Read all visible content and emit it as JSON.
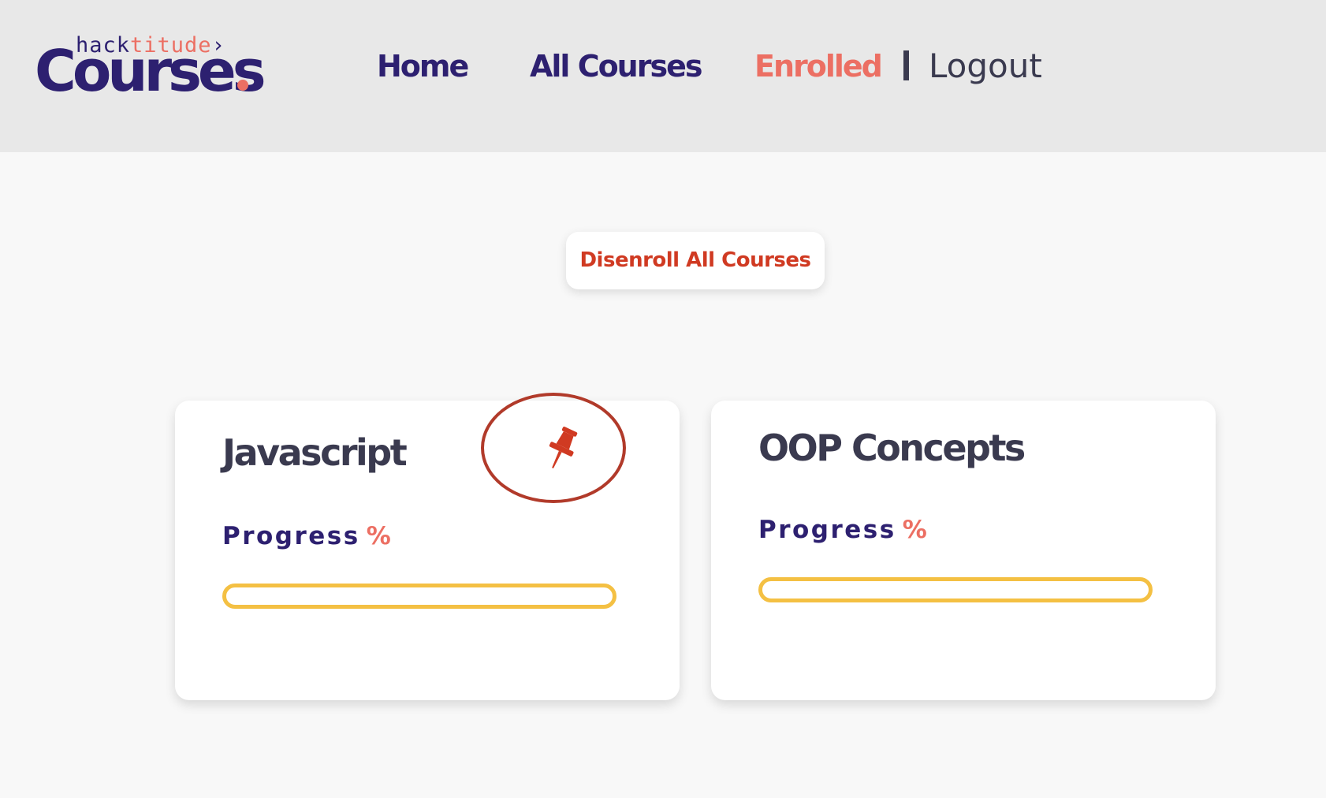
{
  "header": {
    "logo": {
      "top_hack": "hack",
      "top_titude": "titude",
      "top_chevron": "›",
      "main": "Courses"
    },
    "nav": {
      "home": "Home",
      "all_courses": "All Courses",
      "enrolled": "Enrolled",
      "logout": "Logout"
    }
  },
  "main": {
    "disenroll_all_label": "Disenroll All Courses",
    "courses": [
      {
        "title": "Javascript",
        "progress_label": "Progress",
        "progress_unit": "%",
        "progress_fraction": 0,
        "pinned": true,
        "pin_icon": "pushpin-icon"
      },
      {
        "title": "OOP Concepts",
        "progress_label": "Progress",
        "progress_unit": "%",
        "progress_fraction": 0,
        "pinned": false
      }
    ]
  },
  "colors": {
    "brand_navy": "#2d2070",
    "brand_coral": "#ec6f63",
    "header_bg": "#e8e8e8",
    "page_bg": "#f8f8f8",
    "danger_text": "#d03a22",
    "progress_yellow": "#f4c043",
    "title_dark": "#3a3a4f",
    "annotation_red": "#b13a2a"
  }
}
